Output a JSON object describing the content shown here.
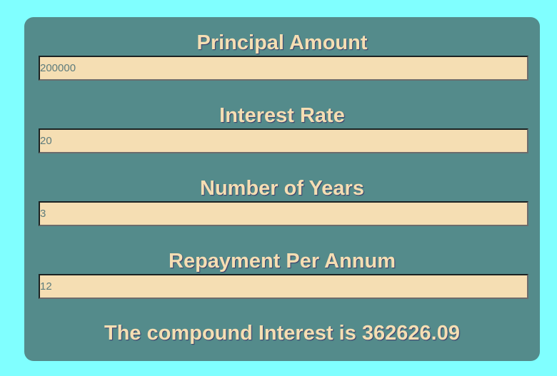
{
  "form": {
    "principal": {
      "label": "Principal Amount",
      "placeholder": "200000"
    },
    "rate": {
      "label": "Interest Rate",
      "placeholder": "20"
    },
    "years": {
      "label": "Number of Years",
      "placeholder": "3"
    },
    "repayment": {
      "label": "Repayment Per Annum",
      "placeholder": "12"
    }
  },
  "result": {
    "text": "The compound Interest is 362626.09"
  },
  "colors": {
    "page_background": "#80ffff",
    "card_background": "#548b8b",
    "label_text": "#f5deb3",
    "input_background": "#f5deb3",
    "input_text": "#5e7c7c"
  }
}
